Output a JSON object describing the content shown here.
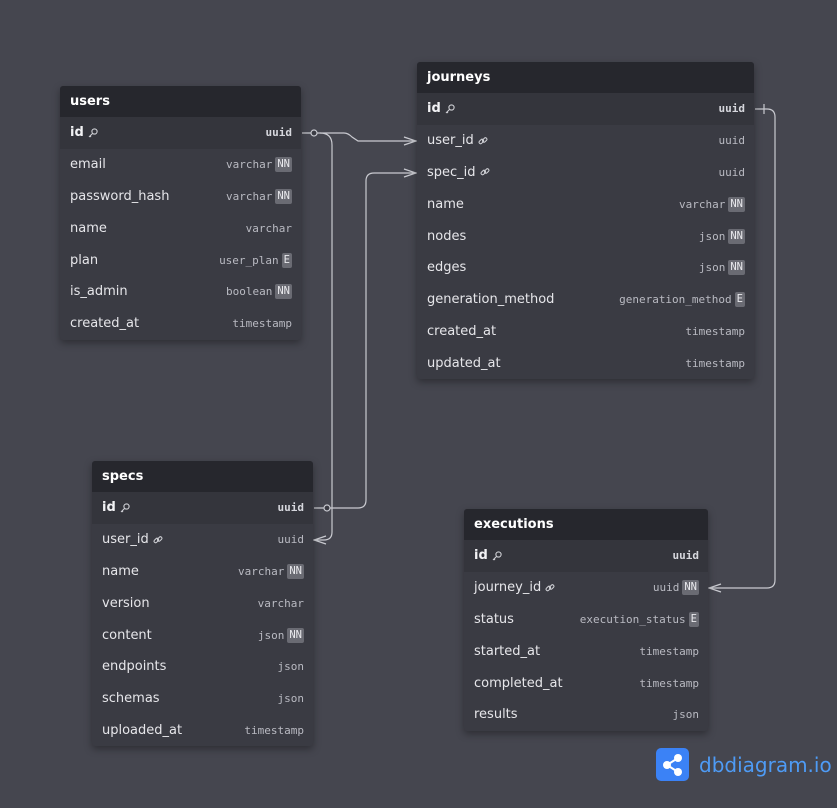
{
  "tables": {
    "users": {
      "title": "users",
      "fields": [
        {
          "name": "id",
          "type": "uuid",
          "pk": true,
          "icon": "key-icon"
        },
        {
          "name": "email",
          "type": "varchar",
          "badge": "NN"
        },
        {
          "name": "password_hash",
          "type": "varchar",
          "badge": "NN"
        },
        {
          "name": "name",
          "type": "varchar"
        },
        {
          "name": "plan",
          "type": "user_plan",
          "badge": "E"
        },
        {
          "name": "is_admin",
          "type": "boolean",
          "badge": "NN"
        },
        {
          "name": "created_at",
          "type": "timestamp"
        }
      ]
    },
    "journeys": {
      "title": "journeys",
      "fields": [
        {
          "name": "id",
          "type": "uuid",
          "pk": true,
          "icon": "key-icon"
        },
        {
          "name": "user_id",
          "type": "uuid",
          "icon": "link-icon"
        },
        {
          "name": "spec_id",
          "type": "uuid",
          "icon": "link-icon"
        },
        {
          "name": "name",
          "type": "varchar",
          "badge": "NN"
        },
        {
          "name": "nodes",
          "type": "json",
          "badge": "NN"
        },
        {
          "name": "edges",
          "type": "json",
          "badge": "NN"
        },
        {
          "name": "generation_method",
          "type": "generation_method",
          "badge": "E"
        },
        {
          "name": "created_at",
          "type": "timestamp"
        },
        {
          "name": "updated_at",
          "type": "timestamp"
        }
      ]
    },
    "specs": {
      "title": "specs",
      "fields": [
        {
          "name": "id",
          "type": "uuid",
          "pk": true,
          "icon": "key-icon"
        },
        {
          "name": "user_id",
          "type": "uuid",
          "icon": "link-icon"
        },
        {
          "name": "name",
          "type": "varchar",
          "badge": "NN"
        },
        {
          "name": "version",
          "type": "varchar"
        },
        {
          "name": "content",
          "type": "json",
          "badge": "NN"
        },
        {
          "name": "endpoints",
          "type": "json"
        },
        {
          "name": "schemas",
          "type": "json"
        },
        {
          "name": "uploaded_at",
          "type": "timestamp"
        }
      ]
    },
    "executions": {
      "title": "executions",
      "fields": [
        {
          "name": "id",
          "type": "uuid",
          "pk": true,
          "icon": "key-icon"
        },
        {
          "name": "journey_id",
          "type": "uuid",
          "badge": "NN",
          "icon": "link-icon"
        },
        {
          "name": "status",
          "type": "execution_status",
          "badge": "E"
        },
        {
          "name": "started_at",
          "type": "timestamp"
        },
        {
          "name": "completed_at",
          "type": "timestamp"
        },
        {
          "name": "results",
          "type": "json"
        }
      ]
    }
  },
  "brand": {
    "text": "dbdiagram.io",
    "icon": "share-icon"
  },
  "colors": {
    "background": "#45464f",
    "table": "#3a3b43",
    "header": "#26272d",
    "brand": "#4e9bf5"
  }
}
